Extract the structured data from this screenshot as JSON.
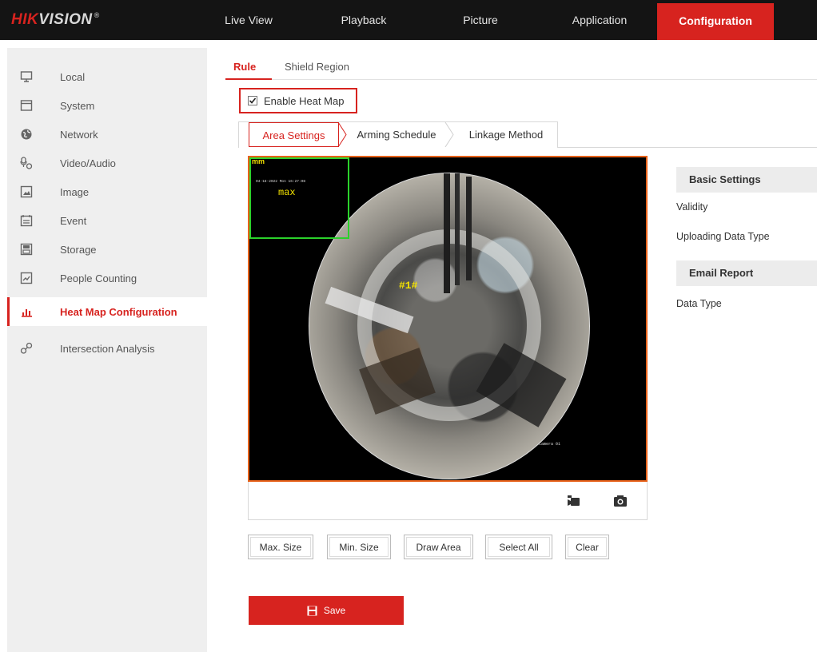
{
  "header": {
    "logo_hik": "HIK",
    "logo_vision": "VISION",
    "logo_reg": "®",
    "nav": [
      "Live View",
      "Playback",
      "Picture",
      "Application",
      "Configuration"
    ],
    "active_nav": "Configuration"
  },
  "sidebar": {
    "items": [
      {
        "label": "Local",
        "icon": "monitor-icon"
      },
      {
        "label": "System",
        "icon": "window-icon"
      },
      {
        "label": "Network",
        "icon": "globe-icon"
      },
      {
        "label": "Video/Audio",
        "icon": "video-audio-icon"
      },
      {
        "label": "Image",
        "icon": "image-icon"
      },
      {
        "label": "Event",
        "icon": "event-icon"
      },
      {
        "label": "Storage",
        "icon": "storage-icon"
      },
      {
        "label": "People Counting",
        "icon": "people-counting-icon"
      },
      {
        "label": "Heat Map Configuration",
        "icon": "heat-map-icon"
      },
      {
        "label": "Intersection Analysis",
        "icon": "intersection-icon"
      }
    ],
    "active_index": 8
  },
  "main": {
    "tabs": [
      "Rule",
      "Shield Region"
    ],
    "active_tab": "Rule",
    "enable_heat_map_label": "Enable Heat Map",
    "enable_heat_map_checked": true,
    "subtabs": [
      "Area Settings",
      "Arming Schedule",
      "Linkage Method"
    ],
    "active_subtab": "Area Settings"
  },
  "video": {
    "osd_datetime": "04-18-2022 Mon 16:27:08",
    "max_tag": "mm",
    "max_text": "max",
    "zone_label": "#1#",
    "camera_label": "Camera 01",
    "toolbar_icons": [
      "record-icon",
      "snapshot-icon"
    ]
  },
  "buttons": [
    "Max. Size",
    "Min. Size",
    "Draw Area",
    "Select All",
    "Clear"
  ],
  "save_label": "Save",
  "right_panel": {
    "basic_settings_title": "Basic Settings",
    "validity_label": "Validity",
    "uploading_data_type_label": "Uploading Data Type",
    "email_report_title": "Email Report",
    "data_type_label": "Data Type"
  },
  "colors": {
    "accent": "#d7231f",
    "topbar": "#141414",
    "sidebar_bg": "#efefef",
    "video_border": "#e8621a",
    "max_box": "#2bd12b"
  }
}
